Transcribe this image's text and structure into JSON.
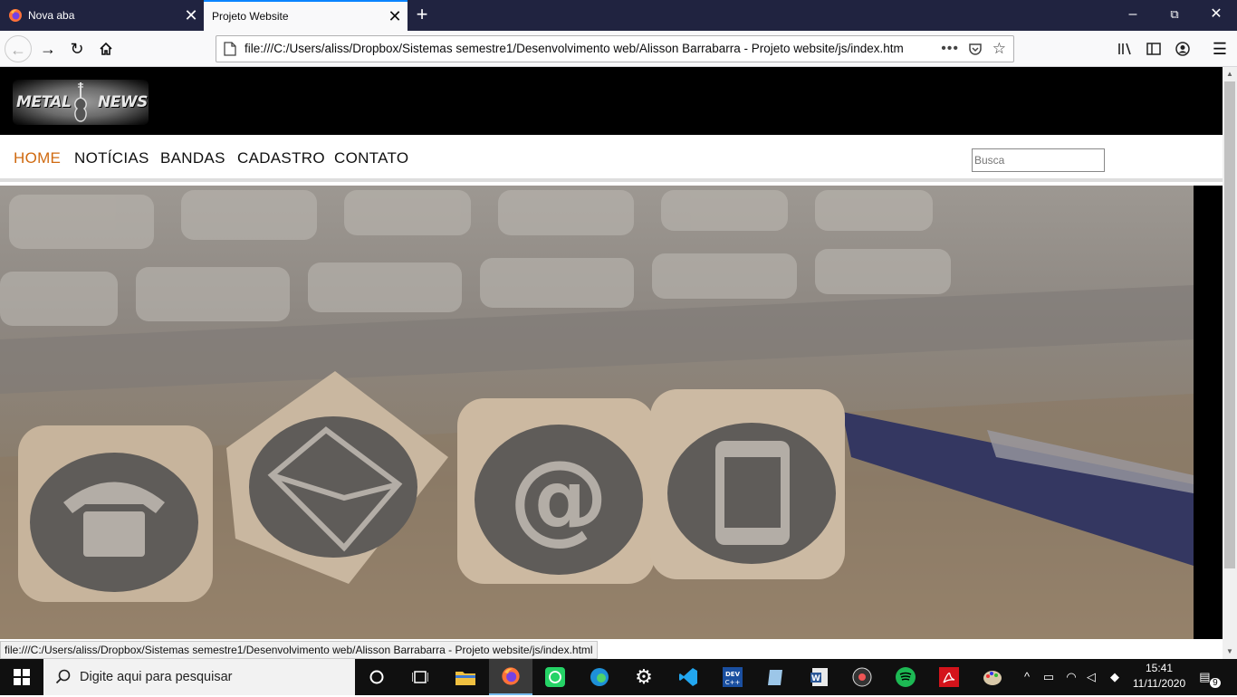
{
  "browser": {
    "tabs": [
      {
        "title": "Nova aba",
        "active": false
      },
      {
        "title": "Projeto Website",
        "active": true
      }
    ],
    "url": "file:///C:/Users/aliss/Dropbox/Sistemas semestre1/Desenvolvimento web/Alisson Barrabarra - Projeto website/js/index.htm",
    "page_actions": "•••",
    "status_url": "file:///C:/Users/aliss/Dropbox/Sistemas semestre1/Desenvolvimento web/Alisson Barrabarra - Projeto website/js/index.html"
  },
  "site": {
    "logo_text_left": "METAL",
    "logo_text_right": "NEWS",
    "menu": [
      {
        "label": "HOME",
        "active": true
      },
      {
        "label": "NOTÍCIAS",
        "active": false
      },
      {
        "label": "BANDAS",
        "active": false
      },
      {
        "label": "CADASTRO",
        "active": false
      },
      {
        "label": "CONTATO",
        "active": false
      }
    ],
    "search_placeholder": "Busca",
    "hero_icons": [
      "phone-icon",
      "envelope-icon",
      "at-sign-icon",
      "smartphone-icon"
    ],
    "accent_color": "#d06a10"
  },
  "taskbar": {
    "search_placeholder": "Digite aqui para pesquisar",
    "apps": [
      "task-view",
      "file-explorer",
      "firefox",
      "whatsapp",
      "edge",
      "settings",
      "vscode",
      "devcpp",
      "notepad",
      "word",
      "media-player",
      "spotify",
      "acrobat",
      "paint"
    ],
    "time": "15:41",
    "date": "11/11/2020",
    "notification_count": "9"
  }
}
